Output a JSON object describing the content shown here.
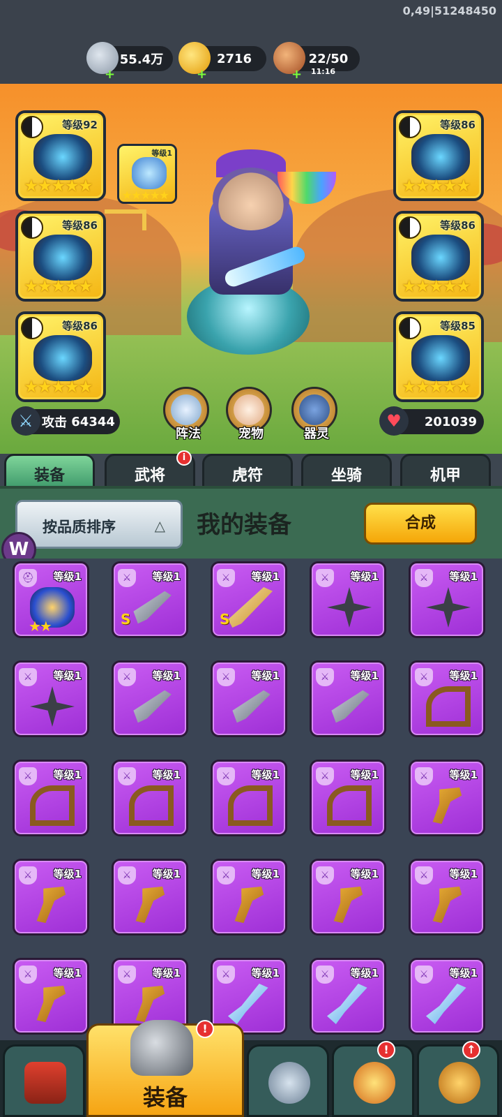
{
  "status": {
    "debug_text": "0,49|51248450"
  },
  "resources": [
    {
      "icon": "silver-coin-icon",
      "value": "55.4万",
      "plus": "+"
    },
    {
      "icon": "gold-ingot-icon",
      "value": "2716",
      "plus": "+"
    },
    {
      "icon": "meat-stamina-icon",
      "value": "22/50",
      "timer": "11:16",
      "plus": "+"
    }
  ],
  "left_slots": [
    {
      "level": "等级92",
      "stars": "★★★★★"
    },
    {
      "level": "等级86",
      "stars": "★★★★★"
    },
    {
      "level": "等级86",
      "stars": "★★★★★"
    }
  ],
  "right_slots": [
    {
      "level": "等级86",
      "stars": "★★★★★"
    },
    {
      "level": "等级86",
      "stars": "★★★★★"
    },
    {
      "level": "等级85",
      "stars": "★★★★★"
    }
  ],
  "sub_slot": {
    "level": "等级1",
    "stars": "★★★★★"
  },
  "stats": {
    "attack_label": "攻击",
    "attack_value": "64344",
    "hp_value": "201039"
  },
  "round_buttons": [
    {
      "label": "阵法"
    },
    {
      "label": "宠物"
    },
    {
      "label": "器灵"
    }
  ],
  "tabs": [
    {
      "label": "装备",
      "active": true
    },
    {
      "label": "武将",
      "badge": "i"
    },
    {
      "label": "虎符"
    },
    {
      "label": "坐骑"
    },
    {
      "label": "机甲"
    }
  ],
  "panel": {
    "sort_label": "按品质排序",
    "sort_arrow": "△",
    "title": "我的装备",
    "merge_label": "合成",
    "logo": "W"
  },
  "items": [
    {
      "level": "等级1",
      "art": "cape",
      "stars": "★★"
    },
    {
      "level": "等级1",
      "art": "dagger",
      "rank": "S"
    },
    {
      "level": "等级1",
      "art": "sword",
      "rank": "S"
    },
    {
      "level": "等级1",
      "art": "shuriken"
    },
    {
      "level": "等级1",
      "art": "shuriken"
    },
    {
      "level": "等级1",
      "art": "shuriken"
    },
    {
      "level": "等级1",
      "art": "dagger"
    },
    {
      "level": "等级1",
      "art": "dagger"
    },
    {
      "level": "等级1",
      "art": "dagger"
    },
    {
      "level": "等级1",
      "art": "bow"
    },
    {
      "level": "等级1",
      "art": "bow"
    },
    {
      "level": "等级1",
      "art": "bow"
    },
    {
      "level": "等级1",
      "art": "bow"
    },
    {
      "level": "等级1",
      "art": "bow"
    },
    {
      "level": "等级1",
      "art": "gun"
    },
    {
      "level": "等级1",
      "art": "gun"
    },
    {
      "level": "等级1",
      "art": "gun"
    },
    {
      "level": "等级1",
      "art": "gun"
    },
    {
      "level": "等级1",
      "art": "gun"
    },
    {
      "level": "等级1",
      "art": "gun"
    },
    {
      "level": "等级1",
      "art": "gun"
    },
    {
      "level": "等级1",
      "art": "gun"
    },
    {
      "level": "等级1",
      "art": "glaive"
    },
    {
      "level": "等级1",
      "art": "glaive"
    },
    {
      "level": "等级1",
      "art": "glaive"
    }
  ],
  "bottom_nav": [
    {
      "icon": "city-gate-icon"
    },
    {
      "icon": "helmet-icon",
      "label": "装备",
      "active": true,
      "alert": "!"
    },
    {
      "icon": "battle-shield-icon"
    },
    {
      "icon": "hero-star-icon",
      "alert": "!"
    },
    {
      "icon": "upgrade-fist-icon",
      "upgrade": "↑"
    }
  ]
}
